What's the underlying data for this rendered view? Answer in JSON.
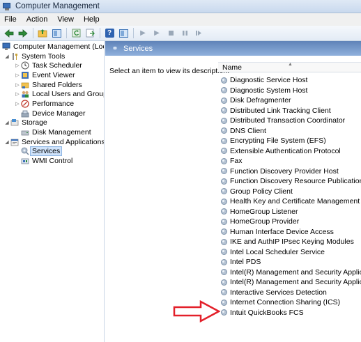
{
  "window": {
    "title": "Computer Management"
  },
  "menu": [
    "File",
    "Action",
    "View",
    "Help"
  ],
  "toolbar": {
    "icons": [
      "back-arrow-icon",
      "forward-arrow-icon",
      "up-folder-icon",
      "show-hide-tree-icon",
      "refresh-icon",
      "export-list-icon",
      "help-icon",
      "properties-icon",
      "start-service-icon",
      "start-icon",
      "stop-service-icon",
      "pause-service-icon",
      "resume-service-icon"
    ]
  },
  "tree": {
    "items": [
      {
        "label": "Computer Management (Local)",
        "level": 0,
        "expander": "",
        "icon": "computer-icon"
      },
      {
        "label": "System Tools",
        "level": 1,
        "expander": "expanded",
        "icon": "tools-icon"
      },
      {
        "label": "Task Scheduler",
        "level": 2,
        "expander": "collapsed",
        "icon": "clock-icon"
      },
      {
        "label": "Event Viewer",
        "level": 2,
        "expander": "collapsed",
        "icon": "event-viewer-icon"
      },
      {
        "label": "Shared Folders",
        "level": 2,
        "expander": "collapsed",
        "icon": "shared-folder-icon"
      },
      {
        "label": "Local Users and Groups",
        "level": 2,
        "expander": "collapsed",
        "icon": "users-icon"
      },
      {
        "label": "Performance",
        "level": 2,
        "expander": "collapsed",
        "icon": "performance-icon"
      },
      {
        "label": "Device Manager",
        "level": 2,
        "expander": "",
        "icon": "device-manager-icon"
      },
      {
        "label": "Storage",
        "level": 1,
        "expander": "expanded",
        "icon": "storage-icon"
      },
      {
        "label": "Disk Management",
        "level": 2,
        "expander": "",
        "icon": "disk-icon"
      },
      {
        "label": "Services and Applications",
        "level": 1,
        "expander": "expanded",
        "icon": "services-apps-icon"
      },
      {
        "label": "Services",
        "level": 2,
        "expander": "",
        "icon": "services-icon",
        "selected": true
      },
      {
        "label": "WMI Control",
        "level": 2,
        "expander": "",
        "icon": "wmi-icon"
      }
    ]
  },
  "panel": {
    "title": "Services",
    "description": "Select an item to view its description.",
    "column_name": "Name"
  },
  "services": [
    "Diagnostic Service Host",
    "Diagnostic System Host",
    "Disk Defragmenter",
    "Distributed Link Tracking Client",
    "Distributed Transaction Coordinator",
    "DNS Client",
    "Encrypting File System (EFS)",
    "Extensible Authentication Protocol",
    "Fax",
    "Function Discovery Provider Host",
    "Function Discovery Resource Publication",
    "Group Policy Client",
    "Health Key and Certificate Management",
    "HomeGroup Listener",
    "HomeGroup Provider",
    "Human Interface Device Access",
    "IKE and AuthIP IPsec Keying Modules",
    "Intel Local Scheduler Service",
    "Intel PDS",
    "Intel(R) Management and Security Applicat...",
    "Intel(R) Management and Security Applicat...",
    "Interactive Services Detection",
    "Internet Connection Sharing (ICS)",
    "Intuit QuickBooks FCS"
  ],
  "colors": {
    "annotation_arrow": "#e3202a",
    "header_blue": "#6f93c8",
    "selection": "#cfe3fb"
  }
}
